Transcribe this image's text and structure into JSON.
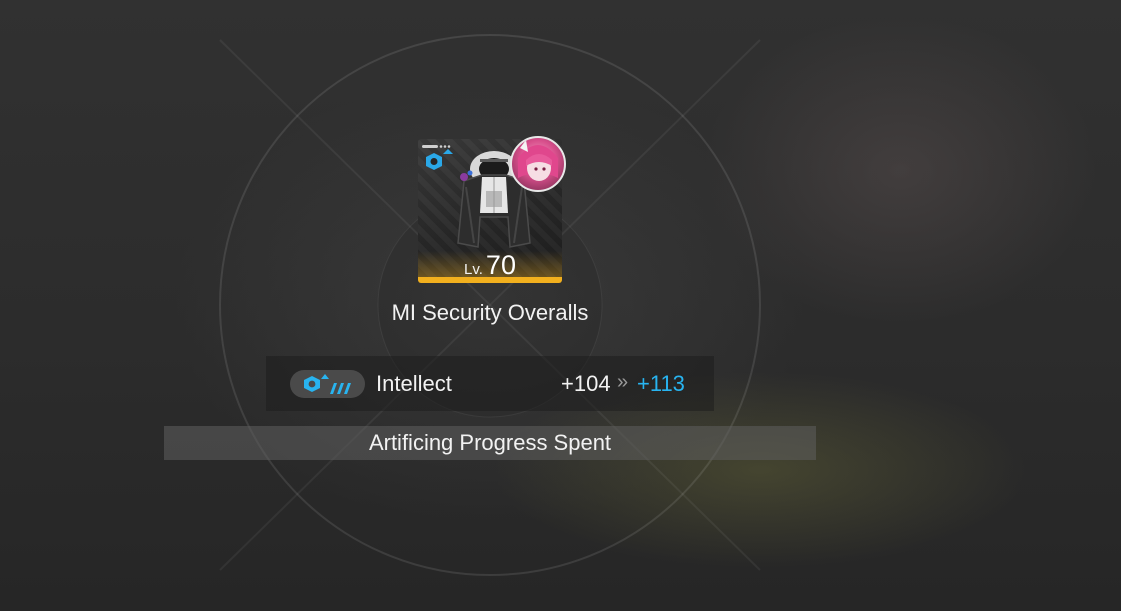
{
  "item": {
    "name": "MI Security Overalls",
    "level_prefix": "Lv.",
    "level_value": "70",
    "rarity_color": "#f2b01e",
    "set_icon": "gear-set-icon",
    "avatar": "character-avatar-pink-hair"
  },
  "stat": {
    "icon": "intellect-attribute-icon",
    "name": "Intellect",
    "old_value": "+104",
    "arrow": "»",
    "new_value": "+113",
    "new_value_color": "#28b4f0"
  },
  "banner": {
    "text": "Artificing Progress Spent"
  }
}
